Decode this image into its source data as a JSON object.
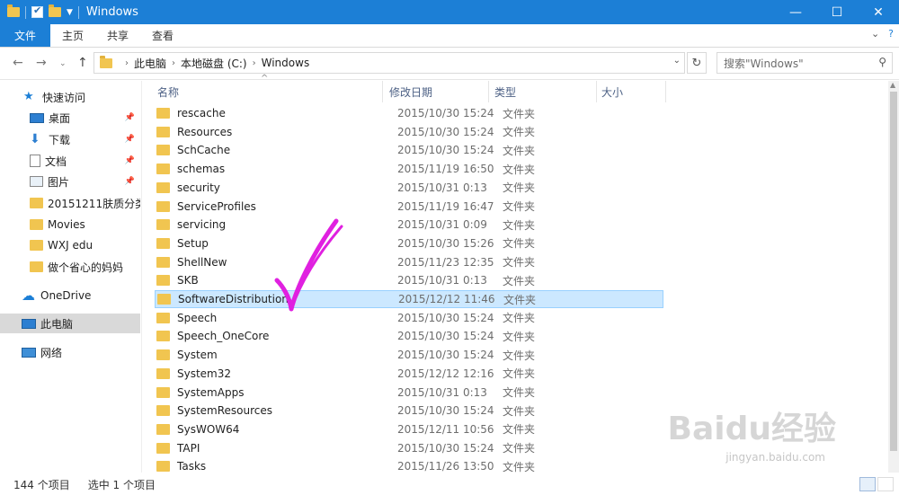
{
  "window": {
    "title": "Windows"
  },
  "ribbon": {
    "tabs": [
      "文件",
      "主页",
      "共享",
      "查看"
    ]
  },
  "nav": {
    "breadcrumb": [
      "此电脑",
      "本地磁盘 (C:)",
      "Windows"
    ],
    "search_placeholder": "搜索\"Windows\""
  },
  "sidebar": {
    "items": [
      {
        "label": "快速访问",
        "icon": "star-icon"
      },
      {
        "label": "桌面",
        "icon": "desktop-icon",
        "pinned": true
      },
      {
        "label": "下载",
        "icon": "download-icon",
        "pinned": true
      },
      {
        "label": "文档",
        "icon": "document-icon",
        "pinned": true
      },
      {
        "label": "图片",
        "icon": "picture-icon",
        "pinned": true
      },
      {
        "label": "20151211肤质分类",
        "icon": "folder-icon"
      },
      {
        "label": "Movies",
        "icon": "folder-icon"
      },
      {
        "label": "WXJ edu",
        "icon": "folder-icon"
      },
      {
        "label": "做个省心的妈妈",
        "icon": "folder-icon"
      },
      {
        "label": "OneDrive",
        "icon": "cloud-icon"
      },
      {
        "label": "此电脑",
        "icon": "pc-icon",
        "selected": true
      },
      {
        "label": "网络",
        "icon": "network-icon"
      }
    ]
  },
  "columns": {
    "name": "名称",
    "date": "修改日期",
    "type": "类型",
    "size": "大小"
  },
  "files": [
    {
      "name": "rescache",
      "date": "2015/10/30 15:24",
      "type": "文件夹"
    },
    {
      "name": "Resources",
      "date": "2015/10/30 15:24",
      "type": "文件夹"
    },
    {
      "name": "SchCache",
      "date": "2015/10/30 15:24",
      "type": "文件夹"
    },
    {
      "name": "schemas",
      "date": "2015/11/19 16:50",
      "type": "文件夹"
    },
    {
      "name": "security",
      "date": "2015/10/31 0:13",
      "type": "文件夹"
    },
    {
      "name": "ServiceProfiles",
      "date": "2015/11/19 16:47",
      "type": "文件夹"
    },
    {
      "name": "servicing",
      "date": "2015/10/31 0:09",
      "type": "文件夹"
    },
    {
      "name": "Setup",
      "date": "2015/10/30 15:26",
      "type": "文件夹"
    },
    {
      "name": "ShellNew",
      "date": "2015/11/23 12:35",
      "type": "文件夹"
    },
    {
      "name": "SKB",
      "date": "2015/10/31 0:13",
      "type": "文件夹"
    },
    {
      "name": "SoftwareDistribution",
      "date": "2015/12/12 11:46",
      "type": "文件夹",
      "selected": true
    },
    {
      "name": "Speech",
      "date": "2015/10/30 15:24",
      "type": "文件夹"
    },
    {
      "name": "Speech_OneCore",
      "date": "2015/10/30 15:24",
      "type": "文件夹"
    },
    {
      "name": "System",
      "date": "2015/10/30 15:24",
      "type": "文件夹"
    },
    {
      "name": "System32",
      "date": "2015/12/12 12:16",
      "type": "文件夹"
    },
    {
      "name": "SystemApps",
      "date": "2015/10/31 0:13",
      "type": "文件夹"
    },
    {
      "name": "SystemResources",
      "date": "2015/10/30 15:24",
      "type": "文件夹"
    },
    {
      "name": "SysWOW64",
      "date": "2015/12/11 10:56",
      "type": "文件夹"
    },
    {
      "name": "TAPI",
      "date": "2015/10/30 15:24",
      "type": "文件夹"
    },
    {
      "name": "Tasks",
      "date": "2015/11/26 13:50",
      "type": "文件夹"
    }
  ],
  "status": {
    "count": "144 个项目",
    "selected": "选中 1 个项目"
  },
  "watermark": {
    "brand": "Baidu经验",
    "url": "jingyan.baidu.com"
  },
  "colors": {
    "accent": "#1c7fd6",
    "selection": "#cce8ff",
    "folder": "#f1c550",
    "annotation": "#e020e0"
  }
}
